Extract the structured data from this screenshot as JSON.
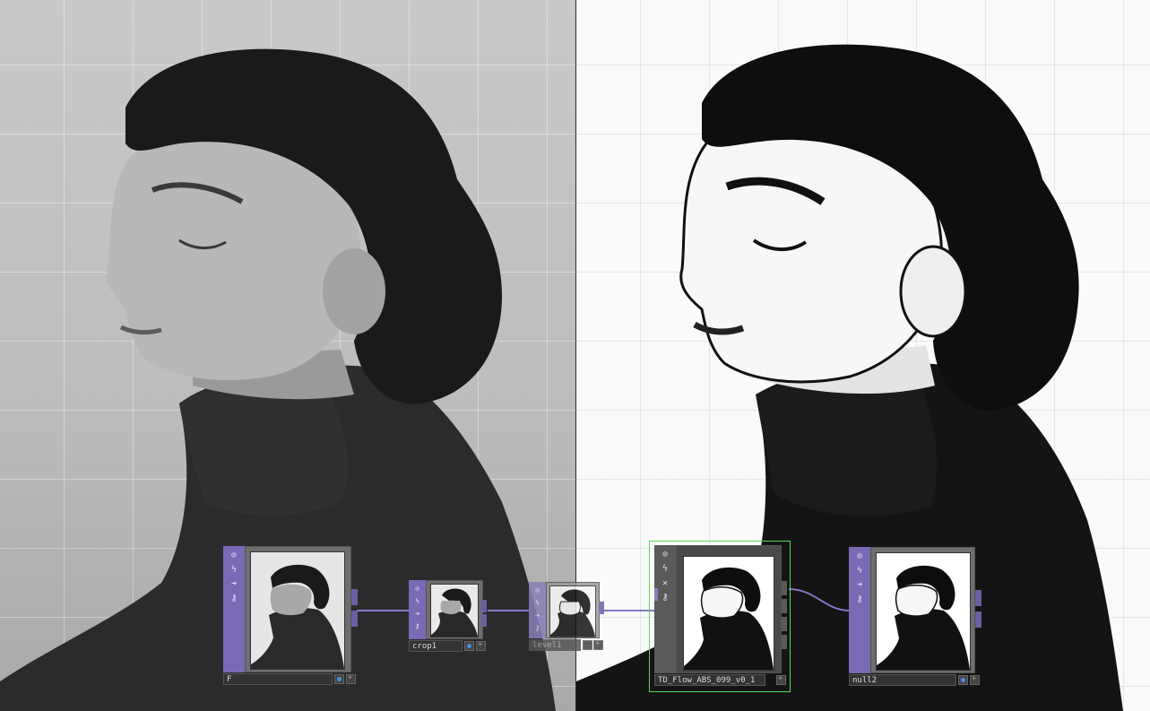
{
  "network": {
    "nodes": [
      {
        "id": "F",
        "label": "F",
        "type": "moviefilein"
      },
      {
        "id": "crop1",
        "label": "crop1",
        "type": "crop"
      },
      {
        "id": "level1",
        "label": "level1",
        "type": "level",
        "bypassed": true
      },
      {
        "id": "td_flow",
        "label": "TD_Flow_ABS_099_v0_1",
        "type": "component",
        "selected": true
      },
      {
        "id": "null2",
        "label": "null2",
        "type": "null"
      }
    ],
    "connections": [
      {
        "from": "F",
        "to": "crop1"
      },
      {
        "from": "crop1",
        "to": "level1"
      },
      {
        "from": "level1",
        "to": "td_flow"
      },
      {
        "from": "td_flow",
        "to": "null2"
      }
    ],
    "node_controls": [
      "viewer-icon",
      "lightning-icon",
      "arrow-right-icon",
      "lock-icon"
    ],
    "component_controls": [
      "viewer-icon",
      "lightning-icon",
      "close-icon",
      "lock-icon"
    ]
  },
  "viewers": {
    "left": {
      "content": "original photo"
    },
    "right": {
      "content": "stylized photo"
    }
  },
  "colors": {
    "node_sidebar": "#7a69b4",
    "wire": "#8577c9",
    "selection": "#52e052",
    "display_flag": "#4a8fe8"
  }
}
